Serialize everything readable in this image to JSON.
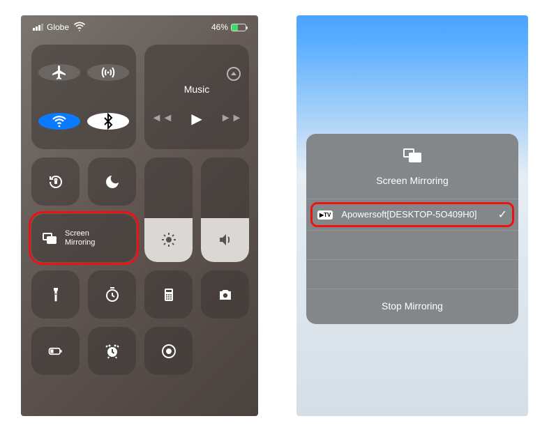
{
  "status": {
    "carrier": "Globe",
    "battery_pct": "46%"
  },
  "control_center": {
    "music_label": "Music",
    "screen_mirroring_label_line1": "Screen",
    "screen_mirroring_label_line2": "Mirroring"
  },
  "mirroring_sheet": {
    "title": "Screen Mirroring",
    "device_name": "Apowersoft[DESKTOP-5O409H0]",
    "device_icon_text": "▶TV",
    "stop_label": "Stop Mirroring"
  }
}
